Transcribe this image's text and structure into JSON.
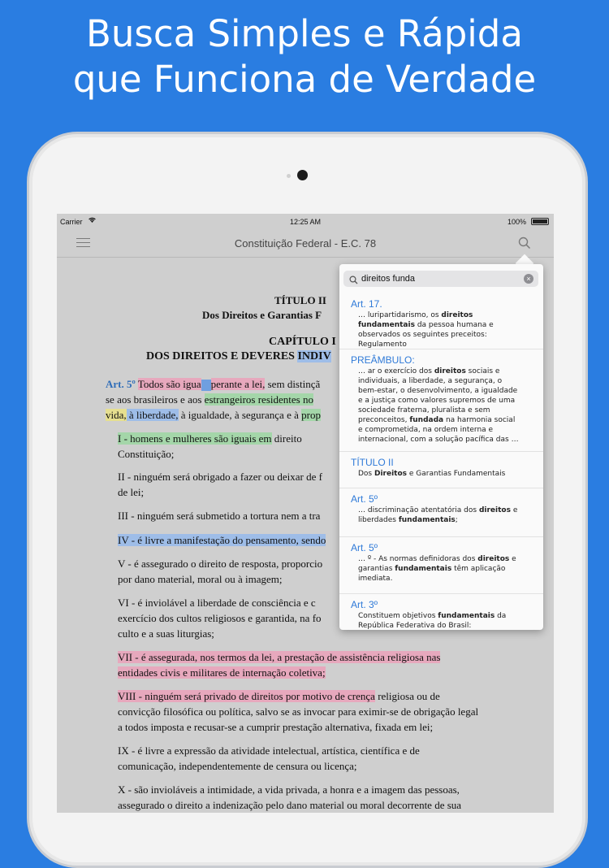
{
  "headline": {
    "line1": "Busca Simples e Rápida",
    "line2": "que Funciona de Verdade"
  },
  "status_bar": {
    "carrier": "Carrier",
    "time": "12:25 AM",
    "battery": "100%"
  },
  "nav": {
    "title": "Constituição Federal - E.C. 78"
  },
  "document": {
    "title_line1": "TÍTULO II",
    "title_line2": "Dos Direitos e Garantias F",
    "chapter_line1": "CAPÍTULO I",
    "chapter_line2_a": "DOS DIREITOS E DEVERES ",
    "chapter_line2_b": "INDIV",
    "art5_label": "Art. 5º",
    "art5_a": "Todos são igua",
    "art5_b": "perante a lei,",
    "art5_c": " sem distinçã",
    "art5_line2_a": "se aos brasileiros e aos ",
    "art5_line2_b": "estrangeiros residentes no",
    "art5_line3_a": "vida,",
    "art5_line3_b": " à liberdade,",
    "art5_line3_c": " à igualdade, à segurança e à ",
    "art5_line3_d": "prop",
    "inc1_a": "I - homens e mulheres são iguais em",
    "inc1_b": " direito",
    "inc1_c": "Constituição;",
    "inc2_a": "II - ninguém será obrigado a fazer ou deixar de f",
    "inc2_b": "de lei;",
    "inc3": "III - ninguém será submetido a tortura nem a tra",
    "inc4_a": "IV - é livre a manifestação do pensamento,",
    "inc4_b": " sendo",
    "inc5_a": "V - é assegurado o direito de resposta, proporcio",
    "inc5_b": "por dano material, moral ou à imagem;",
    "inc6_a": "VI - é inviolável a liberdade de consciência e c",
    "inc6_b": "exercício dos cultos religiosos e garantida, na fo",
    "inc6_c": "culto e a suas liturgias;",
    "inc7_a": "VII - é assegurada, nos termos da lei, a prestação de assistência religiosa nas",
    "inc7_b": "entidades civis e militares de internação coletiva;",
    "inc8_a": "VIII - ninguém será privado de direitos por motivo de crença",
    "inc8_b": " religiosa ou de",
    "inc8_c": "convicção filosófica ou política, salvo se as invocar para eximir-se de obrigação legal",
    "inc8_d": "a todos imposta e recusar-se a cumprir prestação alternativa, fixada em lei;",
    "inc9_a": "IX - é livre a expressão da atividade intelectual, artística, científica e de",
    "inc9_b": "comunicação, independentemente de censura ou licença;",
    "inc10_a": "X - são invioláveis a intimidade, a vida privada, a honra e a imagem das pessoas,",
    "inc10_b": "assegurado o direito a indenização pelo dano material ou moral decorrente de sua"
  },
  "search": {
    "value": "direitos funda",
    "results": [
      {
        "title": "Art. 17.",
        "snippet": [
          [
            "… luripartidarismo, os ",
            false
          ],
          [
            "direitos fundamentais",
            true
          ],
          [
            " da pessoa humana e observados os seguintes preceitos: Regulamento",
            false
          ]
        ]
      },
      {
        "title": "PREÂMBULO:",
        "snippet": [
          [
            "… ar o exercício dos ",
            false
          ],
          [
            "direitos",
            true
          ],
          [
            " sociais e individuais, a liberdade, a segurança, o bem-estar, o desenvolvimento, a igualdade e a justiça como valores supremos de uma sociedade fraterna, pluralista e sem preconceitos, ",
            false
          ],
          [
            "fundada",
            true
          ],
          [
            " na harmonia social e comprometida, na ordem interna e internacional, com a solução pacífica das …",
            false
          ]
        ]
      },
      {
        "title": "TÍTULO II",
        "snippet": [
          [
            "Dos ",
            false
          ],
          [
            "Direitos",
            true
          ],
          [
            " e Garantias Fundamentais",
            false
          ]
        ]
      },
      {
        "title": "Art. 5º",
        "snippet": [
          [
            "… discriminação atentatória dos ",
            false
          ],
          [
            "direitos",
            true
          ],
          [
            " e liberdades ",
            false
          ],
          [
            "fundamentais",
            true
          ],
          [
            ";",
            false
          ]
        ]
      },
      {
        "title": "Art. 5º",
        "snippet": [
          [
            "… º - As normas definidoras dos ",
            false
          ],
          [
            "direitos",
            true
          ],
          [
            " e garantias ",
            false
          ],
          [
            "fundamentais",
            true
          ],
          [
            " têm aplicação imediata.",
            false
          ]
        ]
      },
      {
        "title": "Art. 3º",
        "snippet": [
          [
            "Constituem objetivos ",
            false
          ],
          [
            "fundamentais",
            true
          ],
          [
            " da República Federativa do Brasil:",
            false
          ]
        ]
      }
    ]
  },
  "colors": {
    "background": "#2a7de1",
    "highlight_pink": "#e7a8bd",
    "highlight_green": "#a4d6a9",
    "highlight_blue": "#9ebde8",
    "result_title": "#2f7ad8"
  }
}
